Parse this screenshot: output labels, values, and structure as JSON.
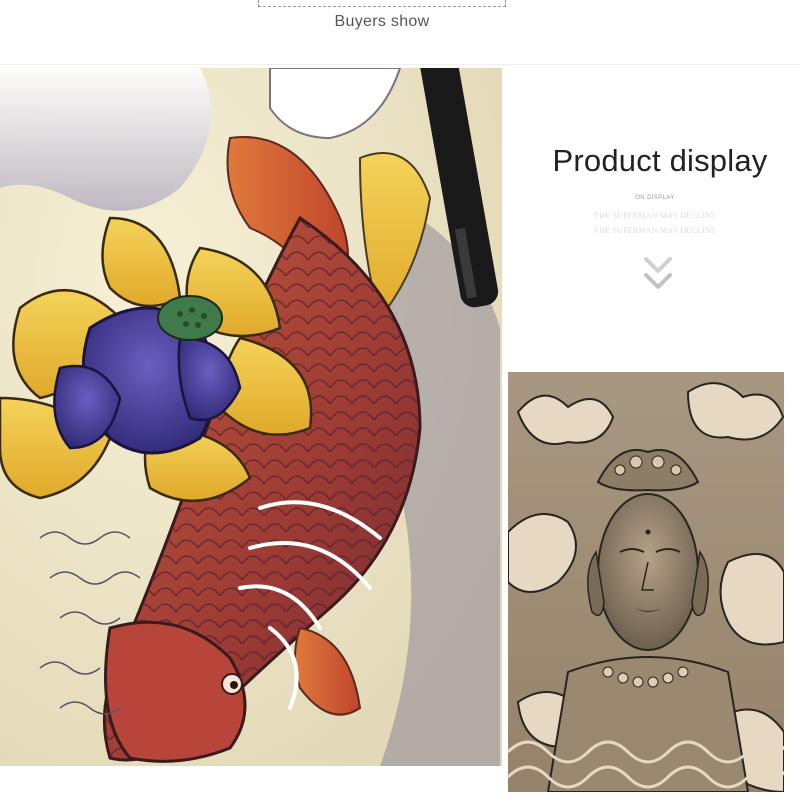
{
  "header": {
    "buyers_show": "Buyers show"
  },
  "side_panel": {
    "title": "Product display",
    "subtitle": "ON DISPLAY",
    "faint_line_1": "THE SUPERMAN MAY DECLINE",
    "faint_line_2": "THE SUPERMAN MAY DECLINE",
    "scroll_icon": "double-chevron-down-icon"
  },
  "images": {
    "left_photo": "koi-fish-lotus-tattoo-sticker",
    "right_photo": "guanyin-bodhisattva-tattoo-sticker"
  },
  "colors": {
    "text_dark": "#222222",
    "text_mid": "#555555",
    "text_faint": "#dcdcdc",
    "chevron": "#c8c8c8"
  }
}
